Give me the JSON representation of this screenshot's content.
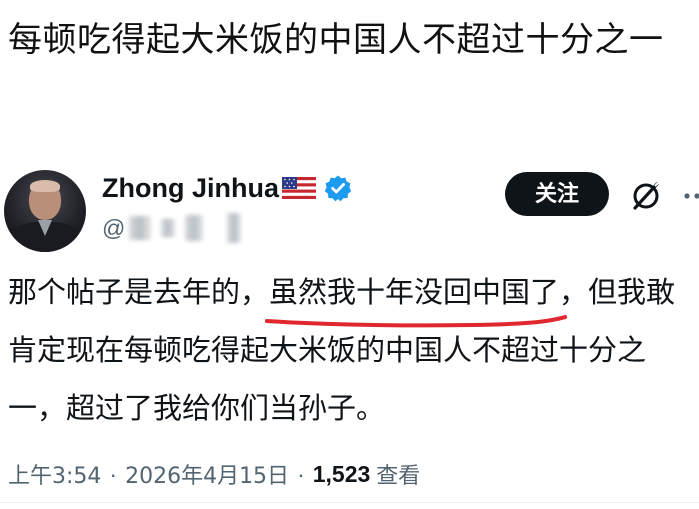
{
  "headline": "每顿吃得起大米饭的中国人不超过十分之一",
  "tweet": {
    "author_name": "Zhong Jinhua",
    "handle_prefix": "@",
    "flag_icon": "us-flag-icon",
    "verified_icon": "verified-badge-icon",
    "verified_color": "#1d9bf0",
    "follow_label": "关注",
    "more_icon": "more-icon",
    "grok_icon": "grok-icon",
    "body": {
      "part1": "那个帖子是去年的，",
      "underlined": "虽然我十年没回中国了",
      "part2": "，但我敢肯定现在每顿吃得起大米饭的中国人不超过十分之一，超过了我给你们当孙子。"
    },
    "underline_color": "#e0282e",
    "meta": {
      "time": "上午3:54",
      "separator": "·",
      "date": "2026年4月15日",
      "views_count": "1,523",
      "views_label": "查看"
    }
  }
}
